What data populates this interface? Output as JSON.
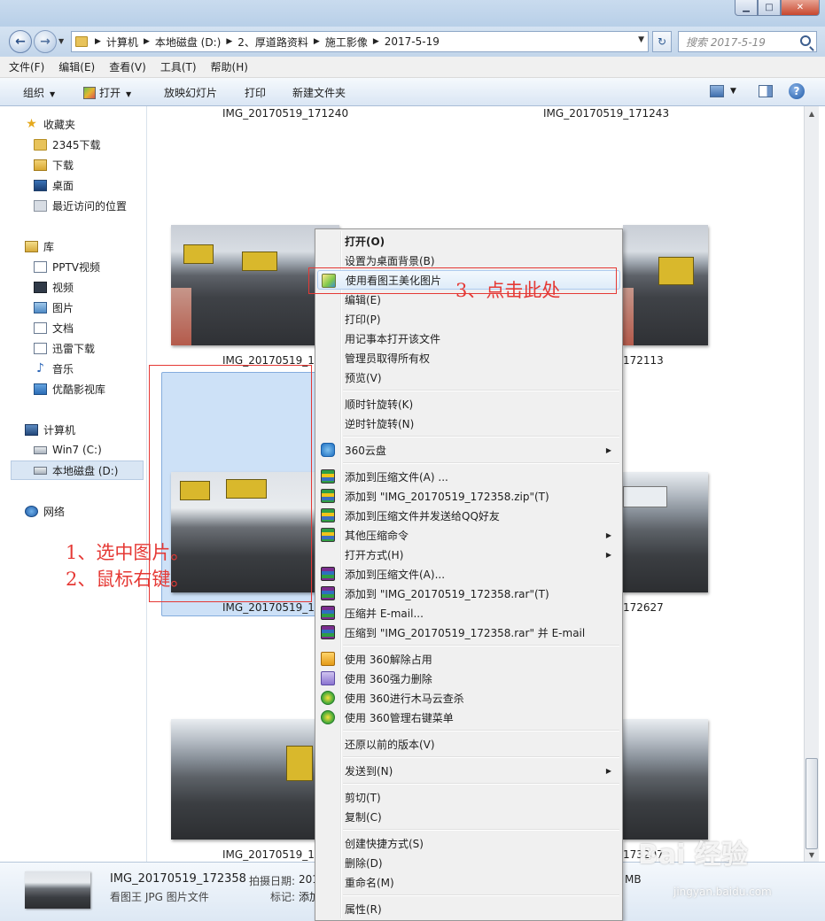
{
  "window": {
    "min_label": "▁",
    "max_label": "□",
    "close_label": "✕"
  },
  "address": {
    "crumbs": [
      "计算机",
      "本地磁盘 (D:)",
      "2、厚道路资料",
      "施工影像",
      "2017-5-19"
    ],
    "search_placeholder": "搜索 2017-5-19"
  },
  "menubar": [
    "文件(F)",
    "编辑(E)",
    "查看(V)",
    "工具(T)",
    "帮助(H)"
  ],
  "toolbar": {
    "organize": "组织",
    "open": "打开",
    "slideshow": "放映幻灯片",
    "print": "打印",
    "new_folder": "新建文件夹"
  },
  "sidebar": {
    "favorites": "收藏夹",
    "fav_items": [
      "2345下载",
      "下载",
      "桌面",
      "最近访问的位置"
    ],
    "libraries": "库",
    "lib_items": [
      "PPTV视频",
      "视频",
      "图片",
      "文档",
      "迅雷下载",
      "音乐",
      "优酷影视库"
    ],
    "computer": "计算机",
    "drives": [
      "Win7 (C:)",
      "本地磁盘 (D:)"
    ],
    "network": "网络"
  },
  "files": {
    "row1": [
      "IMG_20170519_171240",
      "IMG_20170519_171243"
    ],
    "row2": [
      "IMG_20170519_17",
      "172113"
    ],
    "row3": [
      "IMG_20170519_17",
      "172627"
    ],
    "row4": [
      "IMG_20170519_17",
      "173207"
    ]
  },
  "annotations": {
    "step1": "1、选中图片。",
    "step2": "2、鼠标右键。",
    "step3": "3、点击此处"
  },
  "context_menu": {
    "open": "打开(O)",
    "set_bg": "设置为桌面背景(B)",
    "kantu": "使用看图王美化图片",
    "edit": "编辑(E)",
    "print": "打印(P)",
    "notepad": "用记事本打开该文件",
    "admin": "管理员取得所有权",
    "preview": "预览(V)",
    "rotate_cw": "顺时针旋转(K)",
    "rotate_ccw": "逆时针旋转(N)",
    "cloud": "360云盘",
    "zip_add": "添加到压缩文件(A) ...",
    "zip_add_name": "添加到 \"IMG_20170519_172358.zip\"(T)",
    "zip_qq": "添加到压缩文件并发送给QQ好友",
    "zip_other": "其他压缩命令",
    "open_with": "打开方式(H)",
    "rar_add": "添加到压缩文件(A)...",
    "rar_add_name": "添加到 \"IMG_20170519_172358.rar\"(T)",
    "rar_email": "压缩并 E-mail...",
    "rar_email_name": "压缩到 \"IMG_20170519_172358.rar\" 并 E-mail",
    "s360_unlock": "使用 360解除占用",
    "s360_delete": "使用 360强力删除",
    "s360_scan": "使用 360进行木马云查杀",
    "s360_menu": "使用 360管理右键菜单",
    "restore": "还原以前的版本(V)",
    "send_to": "发送到(N)",
    "cut": "剪切(T)",
    "copy": "复制(C)",
    "shortcut": "创建快捷方式(S)",
    "delete": "删除(D)",
    "rename": "重命名(M)",
    "properties": "属性(R)"
  },
  "details": {
    "name": "IMG_20170519_172358",
    "type": "看图王 JPG 图片文件",
    "date_label": "拍摄日期:",
    "date_value": "201",
    "tag_label": "标记:",
    "tag_value": "添加",
    "size_tail": "MB"
  },
  "watermark": {
    "brand": "Bai 经验",
    "url": "jingyan.baidu.com"
  }
}
